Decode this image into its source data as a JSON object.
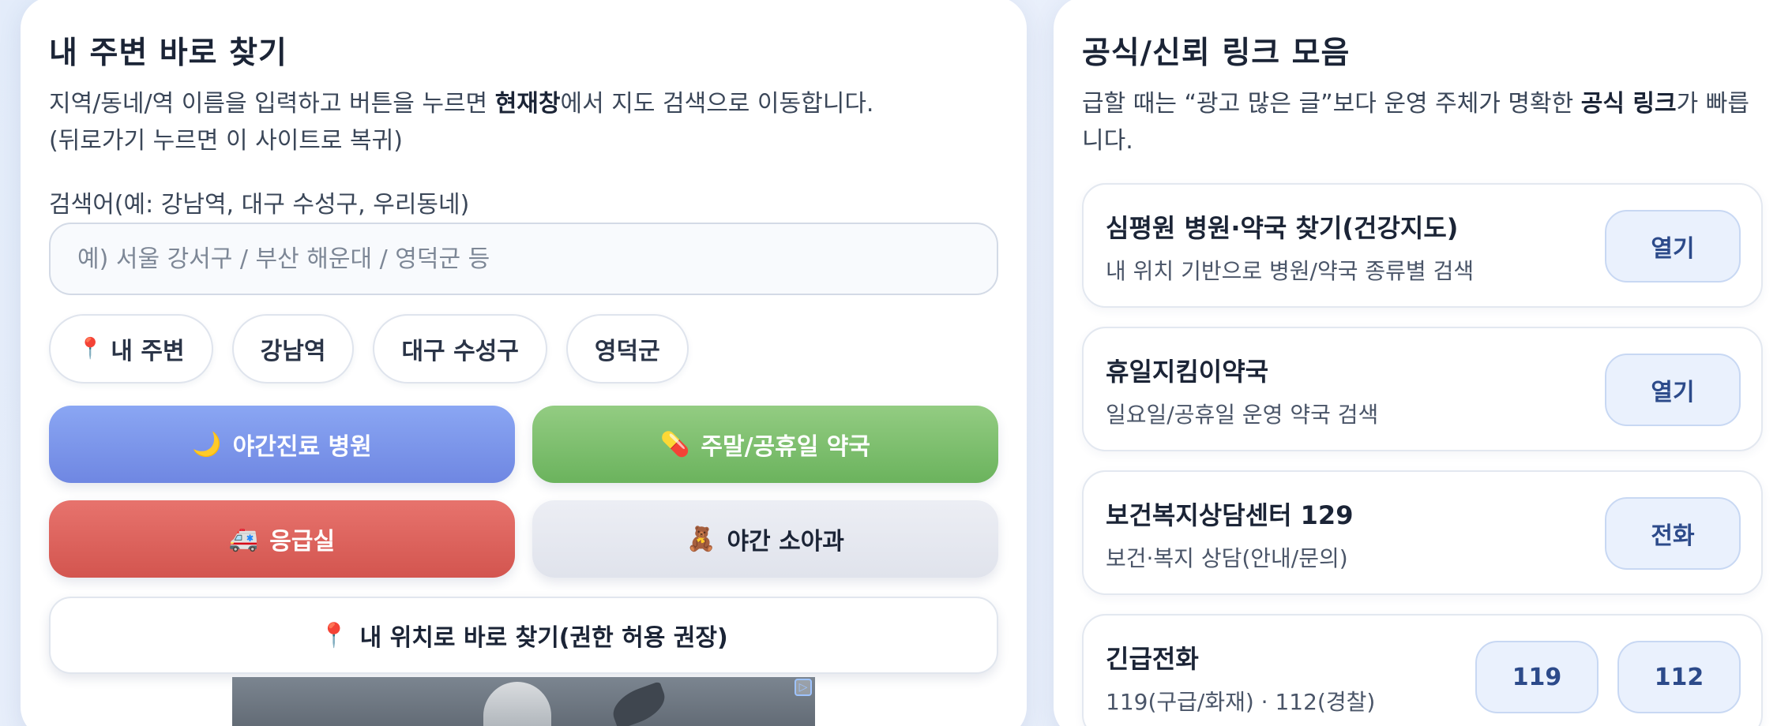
{
  "left": {
    "title": "내 주변 바로 찾기",
    "desc_line1_pre": "지역/동네/역 이름을 입력하고 버튼을 누르면 ",
    "desc_line1_bold": "현재창",
    "desc_line1_post": "에서 지도 검색으로 이동합니다.",
    "desc_line2": "(뒤로가기 누르면 이 사이트로 복귀)",
    "search_label": "검색어(예: 강남역, 대구 수성구, 우리동네)",
    "search_placeholder": "예) 서울 강서구 / 부산 해운대 / 영덕군 등",
    "search_value": "",
    "chips": [
      {
        "label": "내 주변",
        "icon": "📍"
      },
      {
        "label": "강남역"
      },
      {
        "label": "대구 수성구"
      },
      {
        "label": "영덕군"
      }
    ],
    "buttons": {
      "night_hospital": {
        "icon": "🌙",
        "label": "야간진료 병원"
      },
      "weekend_pharmacy": {
        "icon": "💊",
        "label": "주말/공휴일 약국"
      },
      "emergency_room": {
        "icon": "🚑",
        "label": "응급실"
      },
      "night_pediatrics": {
        "icon": "🧸",
        "label": "야간 소아과"
      },
      "my_location": {
        "icon": "📍",
        "label": "내 위치로 바로 찾기(권한 허용 권장)"
      }
    },
    "ad_badge": "▷"
  },
  "right": {
    "title": "공식/신뢰 링크 모음",
    "desc_pre": "급할 때는 “광고 많은 글”보다 운영 주체가 명확한 ",
    "desc_bold": "공식 링크",
    "desc_post": "가 빠릅니다.",
    "links": [
      {
        "title": "심평원 병원·약국 찾기(건강지도)",
        "sub": "내 위치 기반으로 병원/약국 종류별 검색",
        "button": "열기"
      },
      {
        "title": "휴일지킴이약국",
        "sub": "일요일/공휴일 운영 약국 검색",
        "button": "열기"
      },
      {
        "title": "보건복지상담센터 129",
        "sub": "보건·복지 상담(안내/문의)",
        "button": "전화"
      },
      {
        "title": "긴급전화",
        "sub": "119(구급/화재) · 112(경찰)",
        "buttons": [
          "119",
          "112"
        ]
      }
    ]
  },
  "colors": {
    "night_btn": "#7a93e8",
    "weekend_btn": "#7dbf6d",
    "er_btn": "#dc605a",
    "peds_btn": "#e4e7ef",
    "link_btn_bg": "#eaf1fd",
    "link_btn_text": "#2c4a8a"
  }
}
